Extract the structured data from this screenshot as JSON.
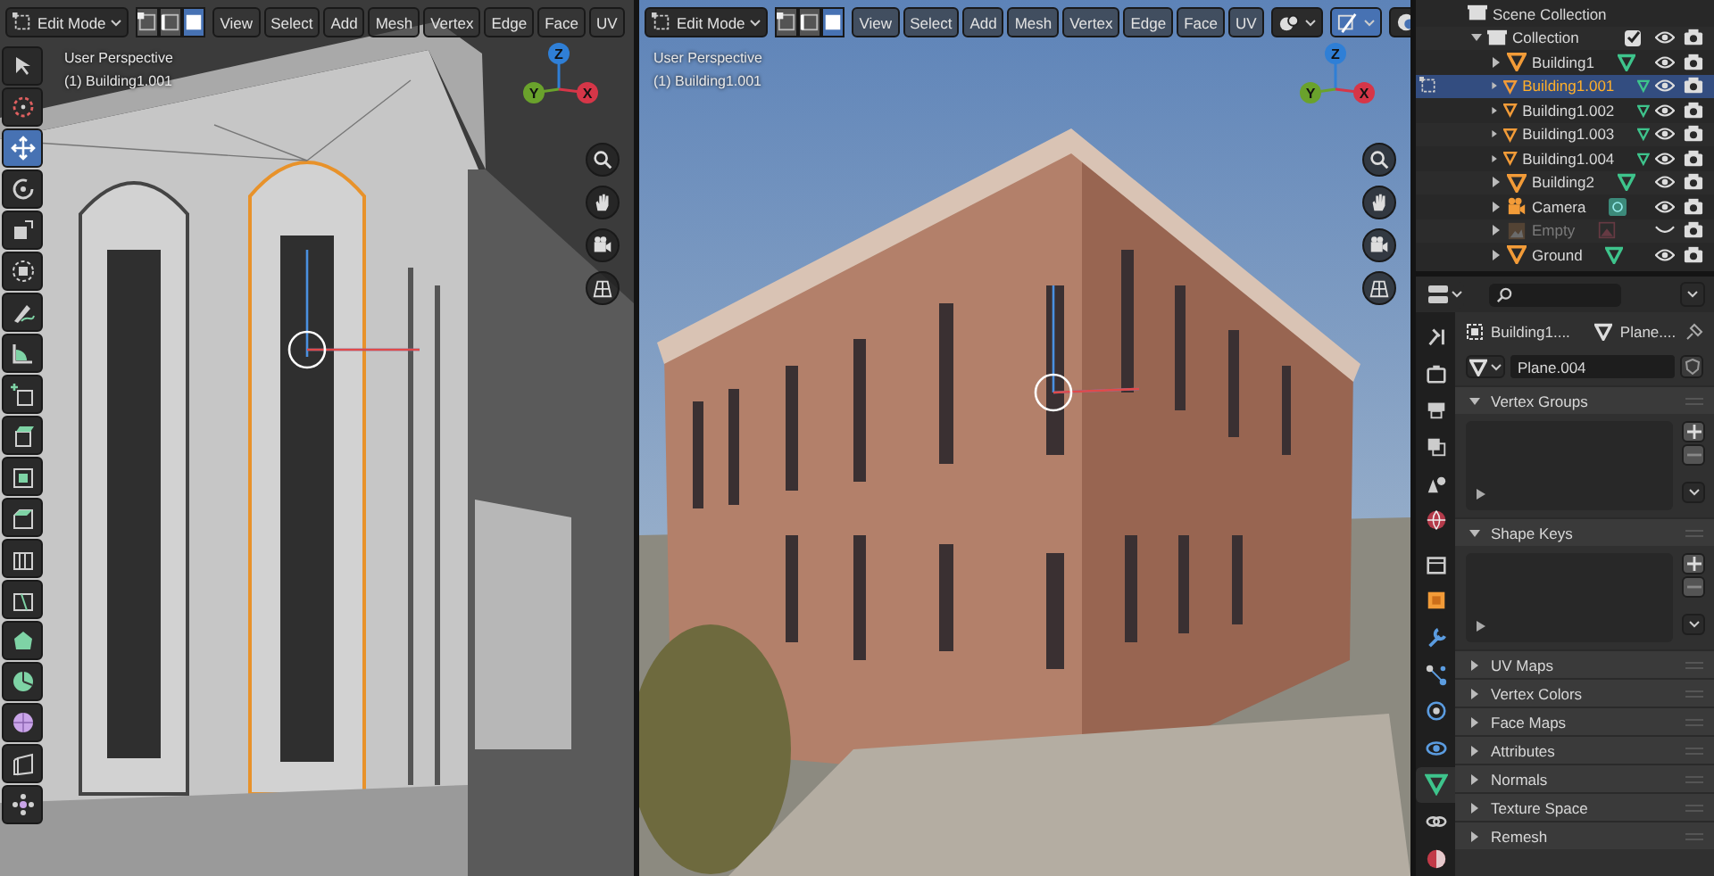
{
  "viewports": [
    {
      "kind": "solid",
      "mode": "Edit Mode",
      "select_modes": [
        {
          "kind": "vertex",
          "selected": false
        },
        {
          "kind": "edge",
          "selected": false
        },
        {
          "kind": "face",
          "selected": true
        }
      ],
      "menus": [
        "View",
        "Select",
        "Add",
        "Mesh",
        "Vertex",
        "Edge",
        "Face",
        "UV"
      ],
      "overlay": [
        "User Perspective",
        "(1) Building1.001"
      ],
      "gizmo": [
        {
          "label": "Z",
          "color": "#2f7fd6"
        },
        {
          "label": "Y",
          "color": "#6aa22c"
        },
        {
          "label": "X",
          "color": "#d63648"
        }
      ],
      "tools": [
        {
          "kind": "select",
          "selected": false
        },
        {
          "kind": "cursor",
          "selected": false
        },
        {
          "kind": "move",
          "selected": true
        },
        {
          "kind": "rotate",
          "selected": false
        },
        {
          "kind": "scale",
          "selected": false
        },
        {
          "kind": "transform",
          "selected": false
        },
        {
          "kind": "annotate",
          "selected": false
        },
        {
          "kind": "measure",
          "selected": false
        },
        {
          "kind": "add_cube",
          "selected": false
        },
        {
          "kind": "extrude",
          "selected": false
        },
        {
          "kind": "inset",
          "selected": false
        },
        {
          "kind": "bevel",
          "selected": false
        },
        {
          "kind": "loop_cut",
          "selected": false
        },
        {
          "kind": "knife",
          "selected": false
        },
        {
          "kind": "poly_build",
          "selected": false
        },
        {
          "kind": "spin",
          "selected": false
        },
        {
          "kind": "smooth",
          "selected": false
        },
        {
          "kind": "shear",
          "selected": false
        },
        {
          "kind": "to_sphere",
          "selected": false
        }
      ]
    },
    {
      "kind": "material",
      "mode": "Edit Mode",
      "select_modes": [
        {
          "kind": "vertex",
          "selected": false
        },
        {
          "kind": "edge",
          "selected": false
        },
        {
          "kind": "face",
          "selected": true
        }
      ],
      "menus": [
        "View",
        "Select",
        "Add",
        "Mesh",
        "Vertex",
        "Edge",
        "Face",
        "UV"
      ],
      "header_extras": [
        {
          "kind": "overlays",
          "selected": false
        },
        {
          "kind": "xray",
          "selected": true
        },
        {
          "kind": "shading",
          "selected": false
        }
      ],
      "overlay": [
        "User Perspective",
        "(1) Building1.001"
      ],
      "gizmo": [
        {
          "label": "Z",
          "color": "#2f7fd6"
        },
        {
          "label": "Y",
          "color": "#6aa22c"
        },
        {
          "label": "X",
          "color": "#d63648"
        }
      ]
    }
  ],
  "outliner": {
    "items": [
      {
        "name": "Scene Collection",
        "kind": "scene",
        "children": [
          {
            "name": "Collection",
            "kind": "collection",
            "expanded": true,
            "checked": true,
            "visible": true,
            "children": [
              {
                "name": "Building1",
                "kind": "mesh",
                "expanded": false,
                "selected": false,
                "disabled": false,
                "visible": true
              },
              {
                "name": "Building1.001",
                "kind": "mesh",
                "expanded": false,
                "selected": true,
                "disabled": false,
                "visible": true
              },
              {
                "name": "Building1.002",
                "kind": "mesh",
                "expanded": false,
                "selected": false,
                "disabled": false,
                "visible": true
              },
              {
                "name": "Building1.003",
                "kind": "mesh",
                "expanded": false,
                "selected": false,
                "disabled": false,
                "visible": true
              },
              {
                "name": "Building1.004",
                "kind": "mesh",
                "expanded": false,
                "selected": false,
                "disabled": false,
                "visible": true
              },
              {
                "name": "Building2",
                "kind": "mesh",
                "expanded": false,
                "selected": false,
                "disabled": false,
                "visible": true
              },
              {
                "name": "Camera",
                "kind": "camera",
                "expanded": false,
                "selected": false,
                "disabled": false,
                "visible": true
              },
              {
                "name": "Empty",
                "kind": "empty",
                "expanded": false,
                "selected": false,
                "disabled": true,
                "visible": false
              },
              {
                "name": "Ground",
                "kind": "mesh",
                "expanded": false,
                "selected": false,
                "disabled": false,
                "visible": true
              }
            ]
          }
        ]
      }
    ]
  },
  "properties": {
    "tabs": [
      {
        "kind": "tool",
        "selected": false
      },
      {
        "kind": "render",
        "selected": false
      },
      {
        "kind": "output",
        "selected": false
      },
      {
        "kind": "view_layer",
        "selected": false
      },
      {
        "kind": "scene",
        "selected": false
      },
      {
        "kind": "world",
        "selected": false
      },
      {
        "kind": "collection",
        "selected": false
      },
      {
        "kind": "object",
        "selected": false
      },
      {
        "kind": "modifier",
        "selected": false
      },
      {
        "kind": "particles",
        "selected": false
      },
      {
        "kind": "physics",
        "selected": false
      },
      {
        "kind": "constraints",
        "selected": false
      },
      {
        "kind": "data",
        "selected": true
      },
      {
        "kind": "texture",
        "selected": false
      },
      {
        "kind": "material",
        "selected": false
      }
    ],
    "breadcrumb": [
      "Building1....",
      "Plane...."
    ],
    "datablock": "Plane.004",
    "panels": [
      {
        "title": "Vertex Groups",
        "expanded": true
      },
      {
        "title": "Shape Keys",
        "expanded": true
      },
      {
        "title": "UV Maps",
        "expanded": false
      },
      {
        "title": "Vertex Colors",
        "expanded": false
      },
      {
        "title": "Face Maps",
        "expanded": false
      },
      {
        "title": "Attributes",
        "expanded": false
      },
      {
        "title": "Normals",
        "expanded": false
      },
      {
        "title": "Texture Space",
        "expanded": false
      },
      {
        "title": "Remesh",
        "expanded": false
      }
    ]
  }
}
